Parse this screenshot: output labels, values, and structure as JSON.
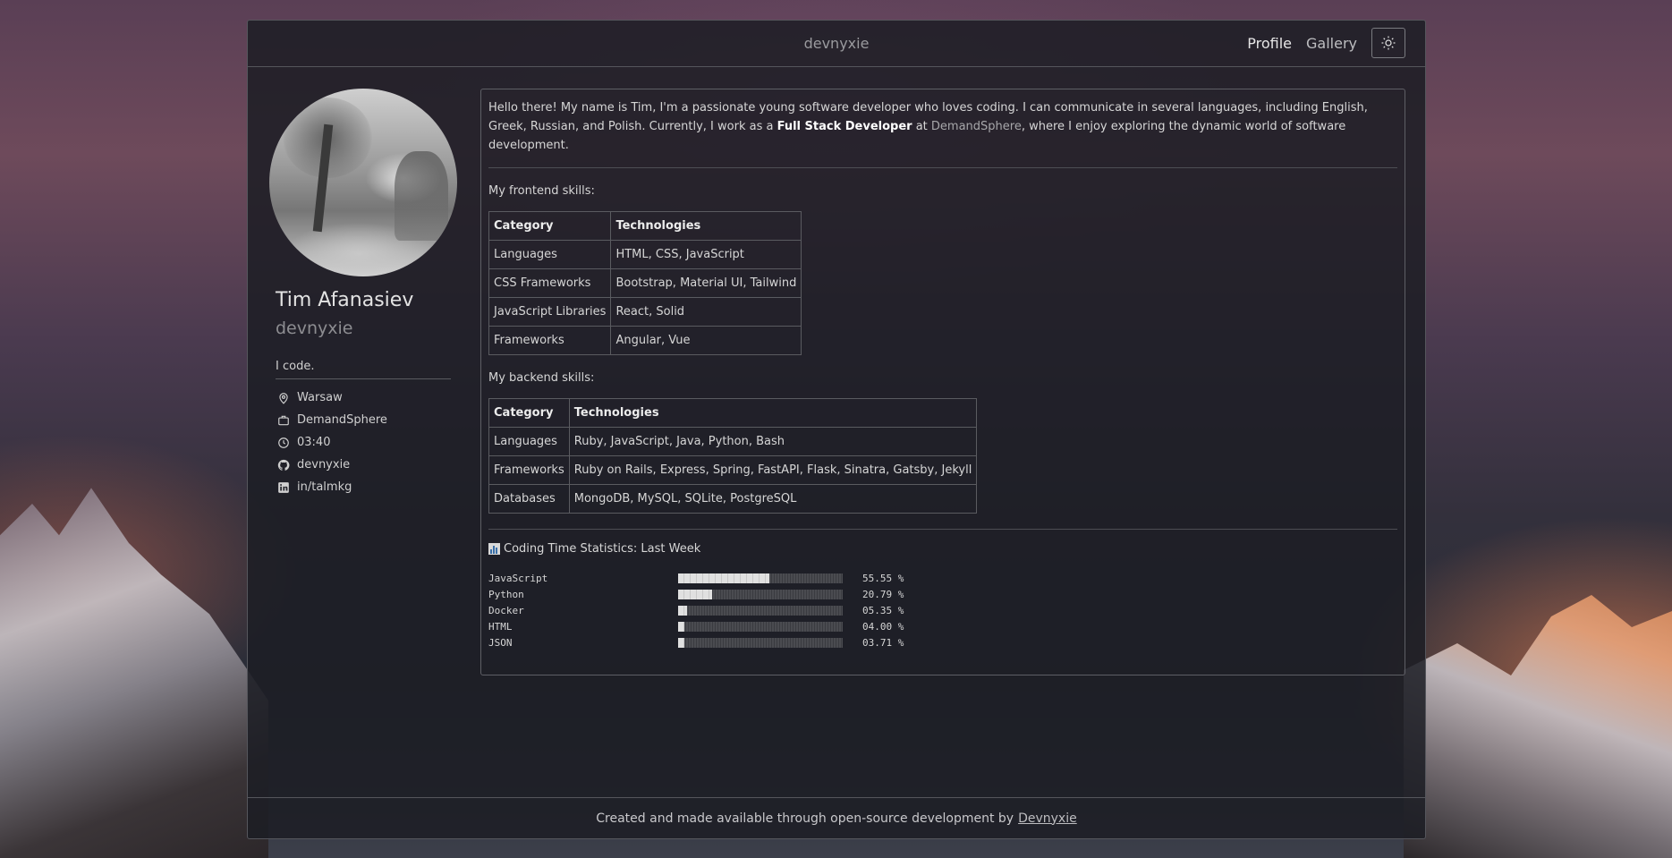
{
  "header": {
    "brand": "devnyxie",
    "nav": [
      "Profile",
      "Gallery"
    ],
    "theme_icon": "sun-icon"
  },
  "profile": {
    "name": "Tim Afanasiev",
    "username": "devnyxie",
    "bio": "I code.",
    "info": [
      {
        "icon": "location-icon",
        "text": "Warsaw"
      },
      {
        "icon": "briefcase-icon",
        "text": "DemandSphere"
      },
      {
        "icon": "clock-icon",
        "text": "03:40"
      },
      {
        "icon": "github-icon",
        "text": "devnyxie"
      },
      {
        "icon": "linkedin-icon",
        "text": "in/talmkg"
      }
    ]
  },
  "intro": {
    "text_1": "Hello there! My name is Tim, I'm a passionate young software developer who loves coding. I can communicate in several languages, including English, Greek, Russian, and Polish. Currently, I work as a ",
    "role": "Full Stack Developer",
    "text_2": " at ",
    "company": "DemandSphere",
    "text_3": ", where I enjoy exploring the dynamic world of software development."
  },
  "frontend": {
    "title": "My frontend skills:",
    "headers": [
      "Category",
      "Technologies"
    ],
    "rows": [
      [
        "Languages",
        "HTML, CSS, JavaScript"
      ],
      [
        "CSS Frameworks",
        "Bootstrap, Material UI, Tailwind"
      ],
      [
        "JavaScript Libraries",
        "React, Solid"
      ],
      [
        "Frameworks",
        "Angular, Vue"
      ]
    ]
  },
  "backend": {
    "title": "My backend skills:",
    "headers": [
      "Category",
      "Technologies"
    ],
    "rows": [
      [
        "Languages",
        "Ruby, JavaScript, Java, Python, Bash"
      ],
      [
        "Frameworks",
        "Ruby on Rails, Express, Spring, FastAPI, Flask, Sinatra, Gatsby, Jekyll"
      ],
      [
        "Databases",
        "MongoDB, MySQL, SQLite, PostgreSQL"
      ]
    ]
  },
  "stats": {
    "title": "Coding Time Statistics: Last Week",
    "items": [
      {
        "lang": "JavaScript",
        "percent": 55.55,
        "label": "55.55 %"
      },
      {
        "lang": "Python",
        "percent": 20.79,
        "label": "20.79 %"
      },
      {
        "lang": "Docker",
        "percent": 5.35,
        "label": "05.35 %"
      },
      {
        "lang": "HTML",
        "percent": 4.0,
        "label": "04.00 %"
      },
      {
        "lang": "JSON",
        "percent": 3.71,
        "label": "03.71 %"
      }
    ]
  },
  "footer": {
    "text": "Created and made available through open-source development by",
    "link": "Devnyxie"
  }
}
